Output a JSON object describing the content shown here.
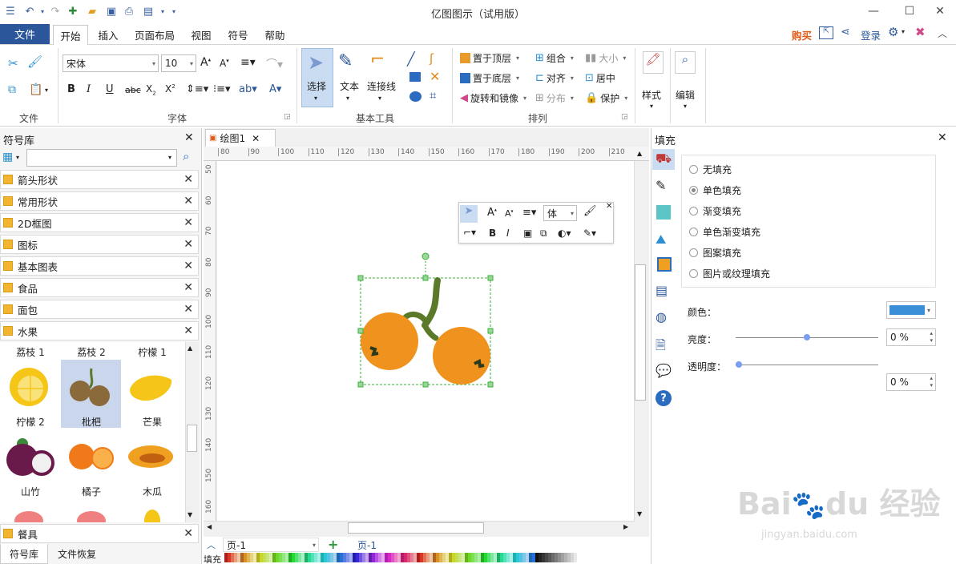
{
  "window": {
    "title": "亿图图示（试用版）"
  },
  "menu": {
    "file": "文件",
    "tabs": [
      "开始",
      "插入",
      "页面布局",
      "视图",
      "符号",
      "帮助"
    ],
    "buy": "购买",
    "login": "登录"
  },
  "ribbon": {
    "groups": {
      "file": "文件",
      "font": "字体",
      "basic_tools": "基本工具",
      "arrange": "排列"
    },
    "font_name": "宋体",
    "font_size": "10",
    "tools": {
      "select": "选择",
      "text": "文本",
      "connector": "连接线"
    },
    "arrange": {
      "bring_front": "置于顶层",
      "send_back": "置于底层",
      "rotate": "旋转和镜像",
      "group": "组合",
      "align": "对齐",
      "distribute": "分布",
      "size": "大小",
      "center": "居中",
      "protect": "保护"
    },
    "style": "样式",
    "edit": "编辑"
  },
  "library": {
    "title": "符号库",
    "search_placeholder": "",
    "categories": [
      "箭头形状",
      "常用形状",
      "2D框图",
      "图标",
      "基本图表",
      "食品",
      "面包",
      "水果"
    ],
    "top_labels": [
      "荔枝 1",
      "荔枝 2",
      "柠檬 1"
    ],
    "shapes": [
      {
        "label": "柠檬 2",
        "icon": "lemon-icon"
      },
      {
        "label": "枇杷",
        "icon": "loquat-icon"
      },
      {
        "label": "芒果",
        "icon": "mango-icon"
      },
      {
        "label": "山竹",
        "icon": "mangosteen-icon"
      },
      {
        "label": "橘子",
        "icon": "orange-icon"
      },
      {
        "label": "木瓜",
        "icon": "papaya-icon"
      }
    ],
    "bottom_category": "餐具",
    "bottom_tabs": [
      "符号库",
      "文件恢复"
    ]
  },
  "document": {
    "tab": "绘图1",
    "ruler_h": [
      "80",
      "90",
      "100",
      "110",
      "120",
      "130",
      "140",
      "150",
      "160",
      "170",
      "180",
      "190",
      "200",
      "210"
    ],
    "ruler_v": [
      "50",
      "60",
      "70",
      "80",
      "90",
      "100",
      "110",
      "120",
      "130",
      "140",
      "150",
      "160"
    ],
    "mini_toolbar_font": "体",
    "page_select": "页-1",
    "page_tab": "页-1",
    "fill_label": "填充"
  },
  "fill_panel": {
    "title": "填充",
    "options": [
      "无填充",
      "单色填充",
      "渐变填充",
      "单色渐变填充",
      "图案填充",
      "图片或纹理填充"
    ],
    "selected_index": 1,
    "color_label": "颜色：",
    "color_value": "#3b8fd8",
    "brightness_label": "亮度：",
    "brightness_value": "0 %",
    "brightness_level": 0.5,
    "transparency_label": "透明度：",
    "transparency_value": "0 %",
    "transparency_level": 0
  },
  "colors": {
    "accent": "#2b579a",
    "orange": "#f0921e",
    "stem": "#5a7a2a",
    "buy": "#e05a1a"
  }
}
